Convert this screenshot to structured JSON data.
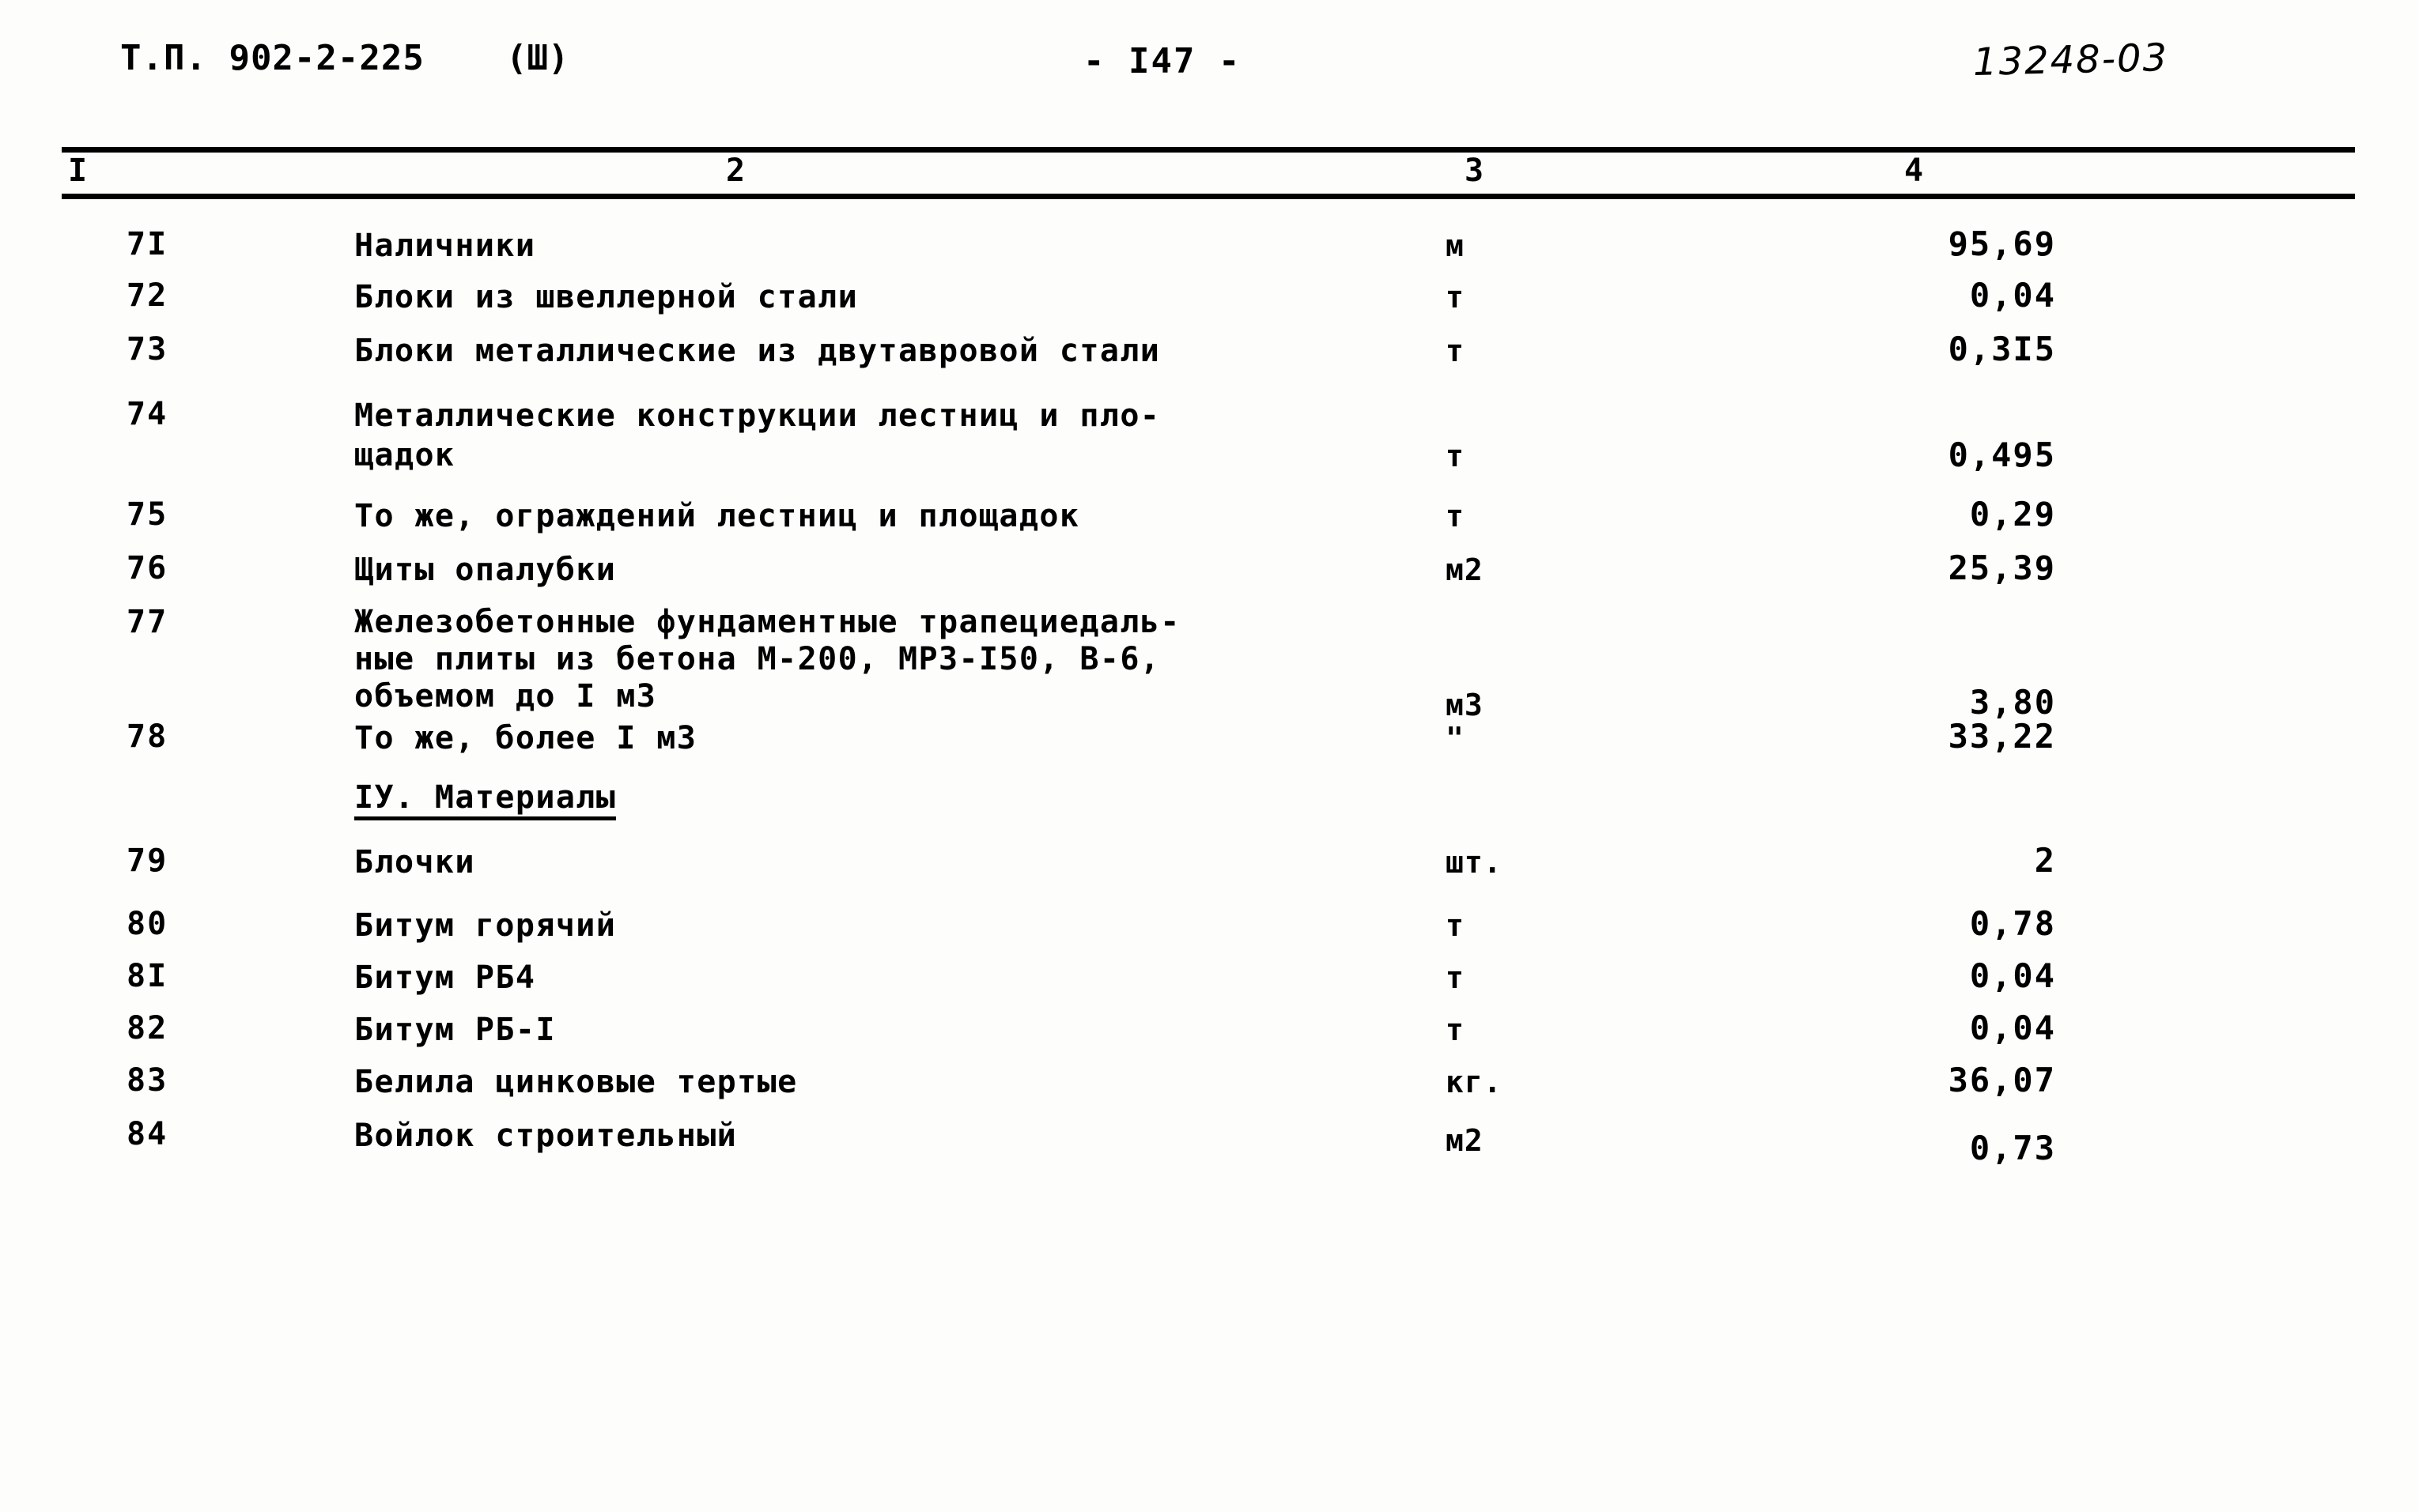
{
  "header": {
    "doc_code": "Т.П. 902-2-225",
    "variant": "(Ш)",
    "page_label": "- I47 -",
    "stamp": "13248-03"
  },
  "table": {
    "column_headers": [
      "I",
      "2",
      "3",
      "4"
    ],
    "rows": [
      {
        "num": "7I",
        "desc": "Наличники",
        "unit": "м",
        "value": "95,69"
      },
      {
        "num": "72",
        "desc": "Блоки из швеллерной стали",
        "unit": "т",
        "value": "0,04"
      },
      {
        "num": "73",
        "desc": "Блоки металлические из двутавровой стали",
        "unit": "т",
        "value": "0,3I5"
      },
      {
        "num": "74",
        "desc": "Металлические конструкции лестниц и пло-\nщадок",
        "unit": "т",
        "value": "0,495"
      },
      {
        "num": "75",
        "desc": "То же, ограждений лестниц и площадок",
        "unit": "т",
        "value": "0,29"
      },
      {
        "num": "76",
        "desc": "Щиты опалубки",
        "unit": "м2",
        "value": "25,39"
      },
      {
        "num": "77",
        "desc": "Железобетонные фундаментные трапециедаль-\nные плиты из бетона М-200, МРЗ-I50, В-6,\nобъемом до I м3",
        "unit": "м3",
        "value": "3,80"
      },
      {
        "num": "78",
        "desc": "То же, более I м3",
        "unit": "\"",
        "value": "33,22"
      },
      {
        "num": "79",
        "desc": "Блочки",
        "unit": "шт.",
        "value": "2"
      },
      {
        "num": "80",
        "desc": "Битум горячий",
        "unit": "т",
        "value": "0,78"
      },
      {
        "num": "8I",
        "desc": "Битум РБ4",
        "unit": "т",
        "value": "0,04"
      },
      {
        "num": "82",
        "desc": "Битум РБ-I",
        "unit": "т",
        "value": "0,04"
      },
      {
        "num": "83",
        "desc": "Белила цинковые тертые",
        "unit": "кг.",
        "value": "36,07"
      },
      {
        "num": "84",
        "desc": "Войлок строительный",
        "unit": "м2",
        "value": "0,73"
      }
    ],
    "section_heading": "IУ. Материалы"
  }
}
